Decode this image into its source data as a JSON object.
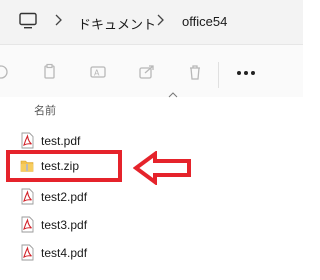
{
  "address_bar": {
    "items": [
      "ドキュメント",
      "office54"
    ]
  },
  "file_list": {
    "column_header": "名前",
    "files": [
      {
        "name": "test.pdf",
        "type": "pdf"
      },
      {
        "name": "test.zip",
        "type": "zip"
      },
      {
        "name": "test2.pdf",
        "type": "pdf"
      },
      {
        "name": "test3.pdf",
        "type": "pdf"
      },
      {
        "name": "test4.pdf",
        "type": "pdf"
      }
    ]
  },
  "highlight": {
    "color": "#e5232b",
    "target": "test.zip"
  }
}
